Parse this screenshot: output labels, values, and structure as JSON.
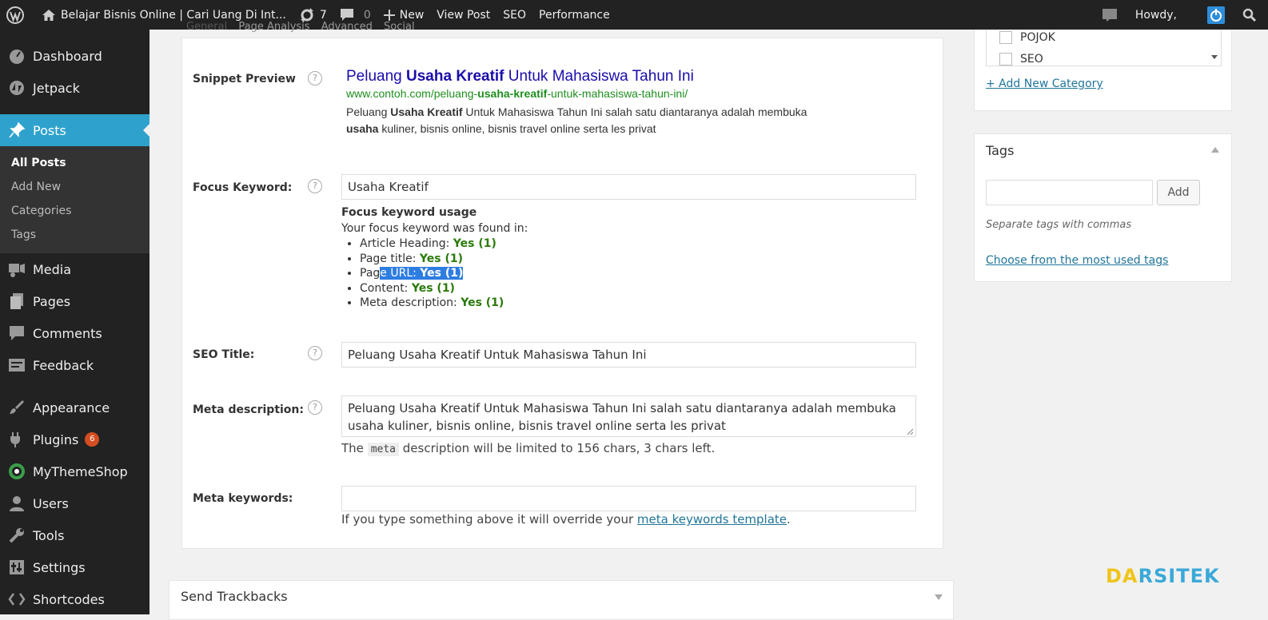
{
  "adminbar": {
    "site_title": "Belajar Bisnis Online | Cari Uang Di Int...",
    "updates": "7",
    "comments": "0",
    "new": "New",
    "view_post": "View Post",
    "seo": "SEO",
    "performance": "Performance",
    "howdy": "Howdy,"
  },
  "sidebar": {
    "dashboard": "Dashboard",
    "jetpack": "Jetpack",
    "posts": "Posts",
    "posts_sub": [
      "All Posts",
      "Add New",
      "Categories",
      "Tags"
    ],
    "media": "Media",
    "pages": "Pages",
    "comments": "Comments",
    "feedback": "Feedback",
    "appearance": "Appearance",
    "plugins": "Plugins",
    "plugins_badge": "6",
    "mythemeshop": "MyThemeShop",
    "users": "Users",
    "tools": "Tools",
    "settings": "Settings",
    "shortcodes": "Shortcodes"
  },
  "seo_tabs": [
    "General",
    "Page Analysis",
    "Advanced",
    "Social"
  ],
  "snippet": {
    "label": "Snippet Preview",
    "title_before": "Peluang ",
    "title_kw": "Usaha Kreatif",
    "title_after": " Untuk Mahasiswa Tahun Ini",
    "url_before": "www.contoh.com/peluang-",
    "url_kw": "usaha-kreatif",
    "url_after": "-untuk-mahasiswa-tahun-ini/",
    "desc_1": "Peluang ",
    "desc_kw1": "Usaha Kreatif",
    "desc_2": " Untuk Mahasiswa Tahun Ini salah satu diantaranya adalah membuka ",
    "desc_kw2": "usaha",
    "desc_3": " kuliner, bisnis online, bisnis travel online serta les privat"
  },
  "focus": {
    "label": "Focus Keyword:",
    "value": "Usaha Kreatif",
    "usage_title": "Focus keyword usage",
    "usage_intro": "Your focus keyword was found in:",
    "items": [
      {
        "label": "Article Heading: ",
        "result": "Yes (1)"
      },
      {
        "label": "Page title: ",
        "result": "Yes (1)"
      },
      {
        "label_start": "Pag",
        "label_selected": "e URL: ",
        "result": "Yes (1)"
      },
      {
        "label": "Content: ",
        "result": "Yes (1)"
      },
      {
        "label": "Meta description: ",
        "result": "Yes (1)"
      }
    ]
  },
  "seo_title": {
    "label": "SEO Title:",
    "value": "Peluang Usaha Kreatif Untuk Mahasiswa Tahun Ini"
  },
  "meta_description": {
    "label": "Meta description:",
    "value": "Peluang Usaha Kreatif Untuk Mahasiswa Tahun Ini salah satu diantaranya adalah membuka usaha kuliner, bisnis online, bisnis travel online serta les privat",
    "note_before": "The",
    "note_code": "meta",
    "note_after": "description will be limited to 156 chars, 3 chars left."
  },
  "meta_keywords": {
    "label": "Meta keywords:",
    "value": "",
    "note_before": "If you type something above it will override your ",
    "note_link": "meta keywords template",
    "note_after": "."
  },
  "help_glyph": "?",
  "trackbacks_title": "Send Trackbacks",
  "categories": {
    "items": [
      "POJOK",
      "SEO"
    ],
    "add_new": "+ Add New Category"
  },
  "tags": {
    "title": "Tags",
    "add_button": "Add",
    "input_value": "",
    "hint": "Separate tags with commas",
    "choose_link": "Choose from the most used tags"
  },
  "watermark": "DARSITEK",
  "colors": {
    "adminbar": "#222222",
    "active_menu": "#2ea2cc",
    "keyword_green": "#2b7a0b",
    "selection": "#2e7de1",
    "badge": "#d54e21"
  }
}
